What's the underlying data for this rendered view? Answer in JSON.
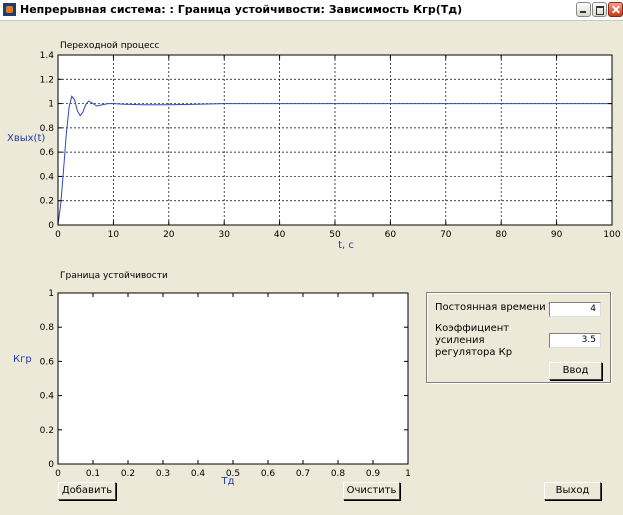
{
  "window": {
    "title": "Непрерывная система: : Граница устойчивости: Зависимость Кгр(Тд)"
  },
  "plot1": {
    "title": "Переходной процесс",
    "xlabel": "t, с",
    "ylabel": "Хвых(t)",
    "x_ticks": [
      "0",
      "10",
      "20",
      "30",
      "40",
      "50",
      "60",
      "70",
      "80",
      "90",
      "100"
    ],
    "y_ticks": [
      "0",
      "0.2",
      "0.4",
      "0.6",
      "0.8",
      "1",
      "1.2",
      "1.4"
    ]
  },
  "plot2": {
    "title": "Граница устойчивости",
    "xlabel": "Тд",
    "ylabel": "Кгр",
    "x_ticks": [
      "0",
      "0.1",
      "0.2",
      "0.3",
      "0.4",
      "0.5",
      "0.6",
      "0.7",
      "0.8",
      "0.9",
      "1"
    ],
    "y_ticks": [
      "0",
      "0.2",
      "0.4",
      "0.6",
      "0.8",
      "1"
    ]
  },
  "params": {
    "td_label": "Постоянная времени Тд",
    "td_value": "4",
    "kp_label": "Коэффициент усиления регулятора Кр",
    "kp_value": "3.5",
    "enter_label": "Ввод"
  },
  "buttons": {
    "add": "Добавить",
    "clear": "Очистить",
    "exit": "Выход"
  },
  "colors": {
    "curve": "#2f48c0",
    "axis_label": "#1e3ca8",
    "background": "#ece9d8"
  },
  "chart_data": [
    {
      "type": "line",
      "title": "Переходной процесс",
      "xlabel": "t, с",
      "ylabel": "Хвых(t)",
      "xlim": [
        0,
        100
      ],
      "ylim": [
        0,
        1.4
      ],
      "grid": true,
      "series": [
        {
          "x": [
            0,
            0.5,
            1,
            1.5,
            2,
            2.5,
            3,
            3.5,
            4,
            4.5,
            5,
            5.5,
            6,
            7,
            8,
            9,
            10,
            12,
            15,
            20,
            25,
            30,
            40,
            50,
            60,
            70,
            80,
            90,
            100
          ],
          "y": [
            0,
            0.18,
            0.45,
            0.75,
            0.97,
            1.06,
            1.03,
            0.94,
            0.9,
            0.93,
            0.99,
            1.02,
            1.01,
            0.98,
            0.99,
            1.0,
            1.0,
            0.995,
            0.99,
            0.99,
            0.995,
            1.0,
            1.0,
            1.0,
            1.0,
            1.0,
            1.0,
            1.0,
            1.0
          ]
        }
      ]
    },
    {
      "type": "line",
      "title": "Граница устойчивости",
      "xlabel": "Тд",
      "ylabel": "Кгр",
      "xlim": [
        0,
        1
      ],
      "ylim": [
        0,
        1
      ],
      "grid": false,
      "series": []
    }
  ]
}
